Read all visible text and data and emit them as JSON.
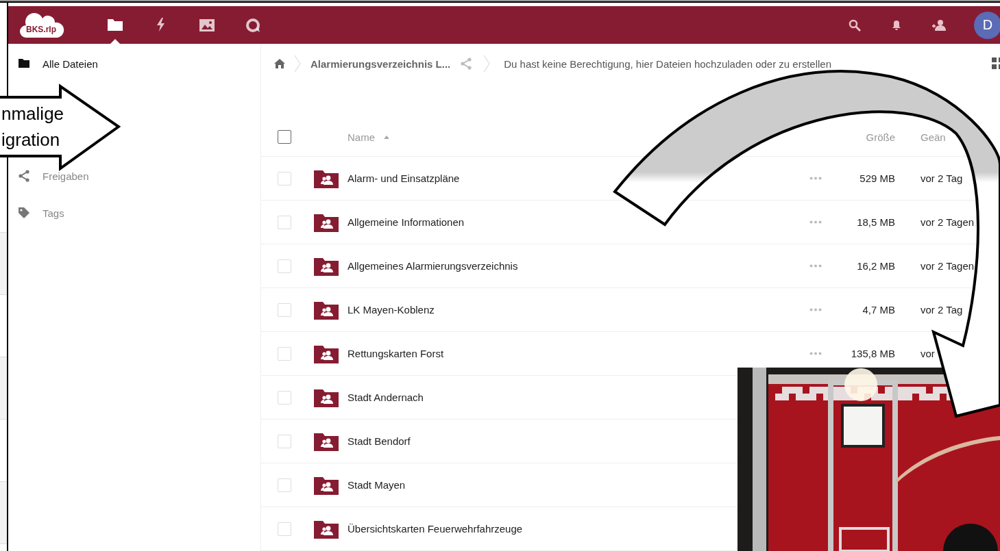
{
  "header": {
    "logo": "BKS.rlp",
    "apps": [
      {
        "kind": "files",
        "selected": true
      },
      {
        "kind": "activity",
        "selected": false
      },
      {
        "kind": "gallery",
        "selected": false
      },
      {
        "kind": "talk",
        "selected": false
      }
    ],
    "avatar": "D"
  },
  "sidebar": {
    "items": [
      {
        "label": "Alle Dateien",
        "kind": "folder",
        "selected": true
      },
      {
        "label": "Freigaben",
        "kind": "share",
        "selected": false
      },
      {
        "label": "Tags",
        "kind": "tag",
        "selected": false
      }
    ]
  },
  "breadcrumb": {
    "folder": "Alarmierungsverzeichnis L...",
    "notice": "Du hast keine Berechtigung, hier Dateien hochzuladen oder zu erstellen"
  },
  "table": {
    "columns": [
      {
        "label": "Name",
        "sorted": true
      },
      {
        "label": "Größe",
        "sorted": false
      },
      {
        "label": "Geän",
        "sorted": false
      }
    ],
    "select_all_checked": false,
    "rows": [
      {
        "name": "Alarm- und Einsatzpläne",
        "size": "529 MB",
        "modified": "vor 2 Tag",
        "checked": false
      },
      {
        "name": "Allgemeine Informationen",
        "size": "18,5 MB",
        "modified": "vor 2 Tagen",
        "checked": false
      },
      {
        "name": "Allgemeines Alarmierungsverzeichnis",
        "size": "16,2 MB",
        "modified": "vor 2 Tagen",
        "checked": false
      },
      {
        "name": "LK Mayen-Koblenz",
        "size": "4,7 MB",
        "modified": "vor 2 Tag",
        "checked": false
      },
      {
        "name": "Rettungskarten Forst",
        "size": "135,8 MB",
        "modified": "vor",
        "checked": false
      },
      {
        "name": "Stadt Andernach",
        "checked": false
      },
      {
        "name": "Stadt Bendorf",
        "checked": false
      },
      {
        "name": "Stadt Mayen",
        "checked": false
      },
      {
        "name": "Übersichtskarten Feuerwehrfahrzeuge",
        "checked": false
      }
    ]
  },
  "callout": {
    "lines": [
      "nmalige",
      "igration"
    ]
  }
}
